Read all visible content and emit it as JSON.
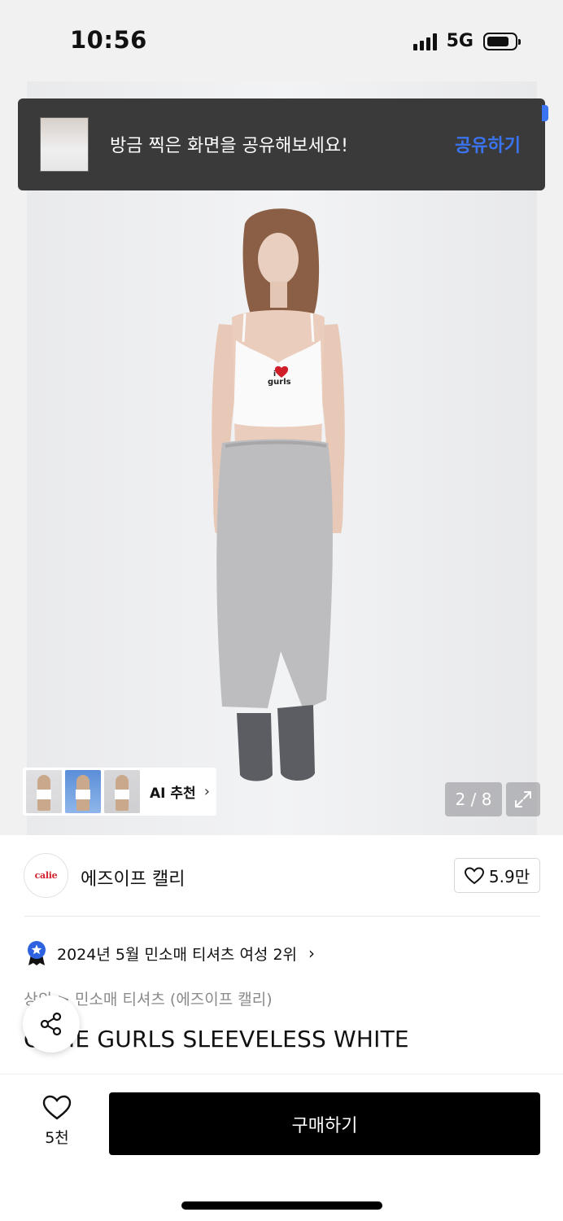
{
  "status_bar": {
    "time": "10:56",
    "network": "5G",
    "battery_level": 0.8
  },
  "toast": {
    "message": "방금 찍은 화면을 공유해보세요!",
    "action_label": "공유하기",
    "action_color": "#3b74f0"
  },
  "gallery": {
    "print_text_top": "i",
    "print_text_bottom": "gurls",
    "ai_recommend_label": "AI 추천",
    "page_indicator": "2 / 8"
  },
  "brand": {
    "logo_text": "calie",
    "name": "에즈이프 캘리",
    "like_count": "5.9만"
  },
  "ranking": {
    "text": "2024년 5월 민소매 티셔츠 여성 2위"
  },
  "breadcrumb": "상의 > 민소매 티셔츠 (에즈이프 캘리)",
  "product": {
    "title": "CALIE GURLS SLEEVELESS WHITE"
  },
  "bottom_bar": {
    "wish_count": "5천",
    "buy_label": "구매하기"
  },
  "icons": [
    "signal-icon",
    "battery-icon",
    "heart-icon",
    "ranking-badge-icon",
    "share-icon",
    "expand-icon",
    "chevron-right-icon"
  ]
}
